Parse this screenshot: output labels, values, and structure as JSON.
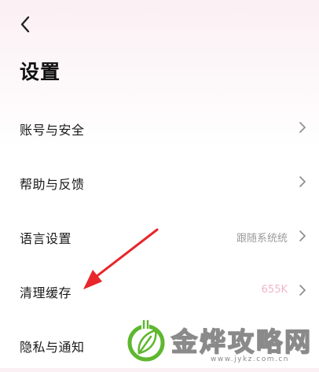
{
  "header": {
    "back_icon": "chevron-left-icon",
    "title": "设置"
  },
  "settings": {
    "items": [
      {
        "label": "账号与安全",
        "value": ""
      },
      {
        "label": "帮助与反馈",
        "value": ""
      },
      {
        "label": "语言设置",
        "value": "跟随系统统"
      },
      {
        "label": "清理缓存",
        "value": "655K"
      },
      {
        "label": "隐私与通知",
        "value": ""
      }
    ]
  },
  "colors": {
    "title": "#111111",
    "value_text": "#9b9b9b",
    "cache_value": "#f0b6c6",
    "annotation_arrow": "#e8262b",
    "watermark_green": "#5fb72f"
  },
  "watermark": {
    "text": "金烨攻略网",
    "url": "www.jykz.com.cn",
    "logo_icon": "green-leaf-plug-icon"
  }
}
